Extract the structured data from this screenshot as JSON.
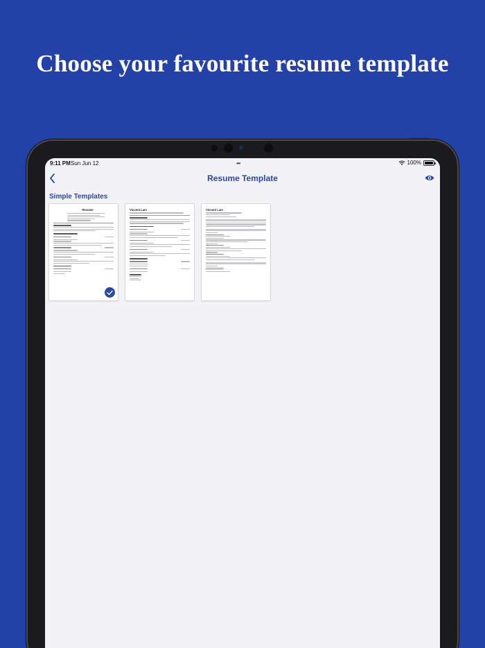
{
  "headline": "Choose your favourite resume template",
  "status": {
    "time": "9:11 PM",
    "date": "Sun Jun 12",
    "battery": "100%",
    "battery_level": 1.0
  },
  "nav": {
    "title": "Resume Template",
    "back_icon": "chevron-left-icon",
    "preview_icon": "eye-icon"
  },
  "section": {
    "title": "Simple Templates"
  },
  "templates": [
    {
      "name": "Resume",
      "selected": true
    },
    {
      "name": "Vincent Lam",
      "selected": false
    },
    {
      "name": "Vincent Lam",
      "selected": false
    }
  ],
  "colors": {
    "background": "#2441a8",
    "accent": "#2a48a6",
    "screen": "#f2f2f7"
  }
}
